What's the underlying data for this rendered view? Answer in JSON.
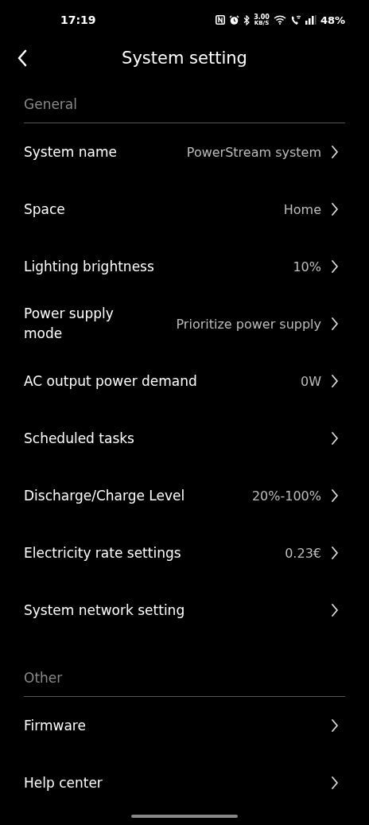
{
  "status_bar": {
    "time": "17:19",
    "speed": "3.00",
    "speed_unit": "KB/S",
    "battery": "48%"
  },
  "header": {
    "title": "System setting"
  },
  "sections": [
    {
      "title": "General",
      "items": [
        {
          "label": "System name",
          "value": "PowerStream system"
        },
        {
          "label": "Space",
          "value": "Home"
        },
        {
          "label": "Lighting brightness",
          "value": "10%"
        },
        {
          "label": "Power supply mode",
          "value": "Prioritize power supply"
        },
        {
          "label": "AC output power demand",
          "value": "0W"
        },
        {
          "label": "Scheduled tasks"
        },
        {
          "label": "Discharge/Charge Level",
          "value": "20%-100%"
        },
        {
          "label": "Electricity rate settings",
          "value": "0.23€"
        },
        {
          "label": "System network setting"
        }
      ]
    },
    {
      "title": "Other",
      "items": [
        {
          "label": "Firmware"
        },
        {
          "label": "Help center"
        }
      ]
    }
  ]
}
